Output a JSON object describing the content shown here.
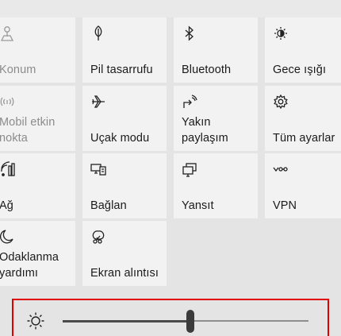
{
  "quick_actions": [
    {
      "label": "Konum",
      "icon": "location-icon",
      "disabled": true
    },
    {
      "label": "Pil tasarrufu",
      "icon": "battery-saver-leaf-icon",
      "disabled": false
    },
    {
      "label": "Bluetooth",
      "icon": "bluetooth-icon",
      "disabled": false
    },
    {
      "label": "Gece ışığı",
      "icon": "night-light-icon",
      "disabled": false
    },
    {
      "label": "Mobil etkin\nnokta",
      "icon": "mobile-hotspot-icon",
      "disabled": true
    },
    {
      "label": "Uçak modu",
      "icon": "airplane-icon",
      "disabled": false
    },
    {
      "label": "Yakın paylaşım",
      "icon": "nearby-sharing-icon",
      "disabled": false
    },
    {
      "label": "Tüm ayarlar",
      "icon": "settings-gear-icon",
      "disabled": false
    },
    {
      "label": "Ağ",
      "icon": "network-icon",
      "disabled": false
    },
    {
      "label": "Bağlan",
      "icon": "connect-icon",
      "disabled": false
    },
    {
      "label": "Yansıt",
      "icon": "project-icon",
      "disabled": false
    },
    {
      "label": "VPN",
      "icon": "vpn-icon",
      "disabled": false
    },
    {
      "label": "Odaklanma\nyardımı",
      "icon": "focus-assist-moon-icon",
      "disabled": false
    },
    {
      "label": "Ekran alıntısı",
      "icon": "snip-icon",
      "disabled": false
    }
  ],
  "brightness": {
    "icon": "brightness-sun-icon",
    "level_percent": 52
  }
}
